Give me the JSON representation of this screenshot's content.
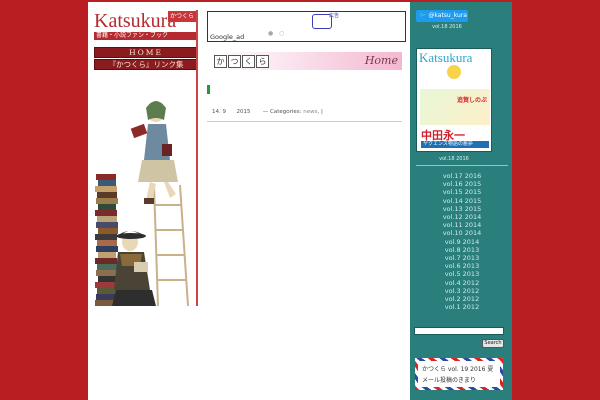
{
  "logo": {
    "title": "Katsukura",
    "stamp": "かつくら",
    "subtitle": "書籍・小説ファン・ブック"
  },
  "nav": {
    "home": "HOME",
    "links": "『かつくら』リンク集"
  },
  "ad": {
    "label": "Google_ad",
    "corner": "広告"
  },
  "header": {
    "kana": [
      "か",
      "つ",
      "く",
      "ら"
    ],
    "home_script": "Home"
  },
  "post": {
    "date_a": "14. 9",
    "date_b": "2015",
    "categories_label": "— Categories:",
    "category": "news",
    "sep": ", |"
  },
  "sidebar": {
    "twitter": "@katsu_kura",
    "current_vol_top": "vol.18 2016",
    "cover": {
      "title": "Katsukura",
      "blurb": "追賀しのぶ",
      "name": "中田永一",
      "band": "ヤクエンス物語の悪夢"
    },
    "current_vol_caption": "vol.18 2016",
    "volumes": [
      "vol.17 2016",
      "vol.16 2015",
      "vol.15 2015",
      "vol.14 2015",
      "vol.13 2015",
      "vol.12 2014",
      "vol.11 2014",
      "vol.10 2014",
      "vol.9 2014",
      "vol.8 2013",
      "vol.7 2013",
      "vol.6 2013",
      "vol.5 2013",
      "vol.4 2012",
      "vol.3 2012",
      "vol.2 2012",
      "vol.1 2012"
    ],
    "search_label": "Search",
    "mail_line1": "かつくら vol. 19 2016 夏",
    "mail_line2": "メール投稿のきまり"
  },
  "colors": {
    "background": "#b81e22",
    "sidebar": "#2a7e7c",
    "accent": "#b52a2e",
    "twitter": "#1d9bf0"
  }
}
